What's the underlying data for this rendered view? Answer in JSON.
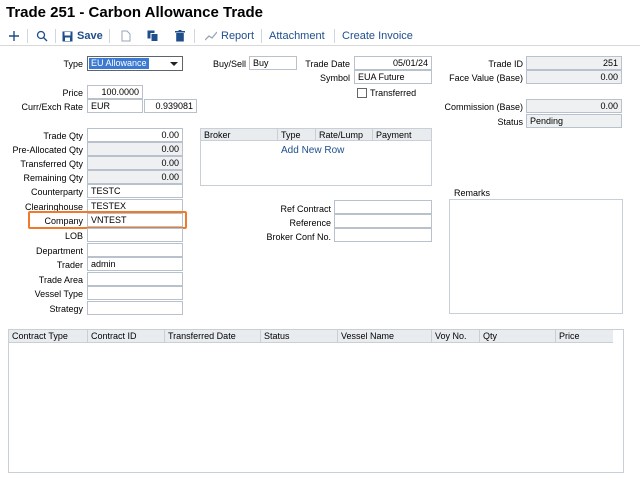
{
  "title": "Trade 251 - Carbon Allowance Trade",
  "toolbar": {
    "save": "Save",
    "report": "Report",
    "attachment": "Attachment",
    "create_invoice": "Create Invoice"
  },
  "header": {
    "type_label": "Type",
    "type_value": "EU Allowance",
    "buysell_label": "Buy/Sell",
    "buysell_value": "Buy",
    "tradedate_label": "Trade Date",
    "tradedate_value": "05/01/24",
    "symbol_label": "Symbol",
    "symbol_value": "EUA Future",
    "transferred_label": "Transferred",
    "tradeid_label": "Trade ID",
    "tradeid_value": "251",
    "facevalue_label": "Face Value (Base)",
    "facevalue_value": "0.00",
    "price_label": "Price",
    "price_value": "100.0000",
    "currexch_label": "Curr/Exch Rate",
    "curr_value": "EUR",
    "exch_value": "0.939081",
    "commission_label": "Commission (Base)",
    "commission_value": "0.00",
    "status_label": "Status",
    "status_value": "Pending"
  },
  "qty": {
    "trade_qty_label": "Trade Qty",
    "trade_qty": "0.00",
    "preallocated_label": "Pre-Allocated Qty",
    "preallocated": "0.00",
    "transferred_label": "Transferred Qty",
    "transferred": "0.00",
    "remaining_label": "Remaining Qty",
    "remaining": "0.00"
  },
  "parties": {
    "counterparty_label": "Counterparty",
    "counterparty": "TESTC",
    "clearinghouse_label": "Clearinghouse",
    "clearinghouse": "TESTEX",
    "company_label": "Company",
    "company": "VNTEST",
    "lob_label": "LOB",
    "lob": "",
    "department_label": "Department",
    "department": "",
    "trader_label": "Trader",
    "trader": "admin",
    "tradearea_label": "Trade Area",
    "tradearea": "",
    "vesseltype_label": "Vessel Type",
    "vesseltype": "",
    "strategy_label": "Strategy",
    "strategy": ""
  },
  "broker_grid": {
    "columns": [
      "Broker",
      "Type",
      "Rate/Lump",
      "Payment"
    ],
    "add_new_row": "Add New Row"
  },
  "refs": {
    "ref_contract_label": "Ref Contract",
    "reference_label": "Reference",
    "broker_conf_label": "Broker Conf No."
  },
  "remarks_label": "Remarks",
  "contracts_grid": {
    "columns": [
      "Contract Type",
      "Contract ID",
      "Transferred Date",
      "Status",
      "Vessel Name",
      "Voy No.",
      "Qty",
      "Price"
    ]
  },
  "colors": {
    "accent": "#1f4e8c",
    "highlight": "#f07a2c",
    "select_fill": "#3b7ad0"
  }
}
